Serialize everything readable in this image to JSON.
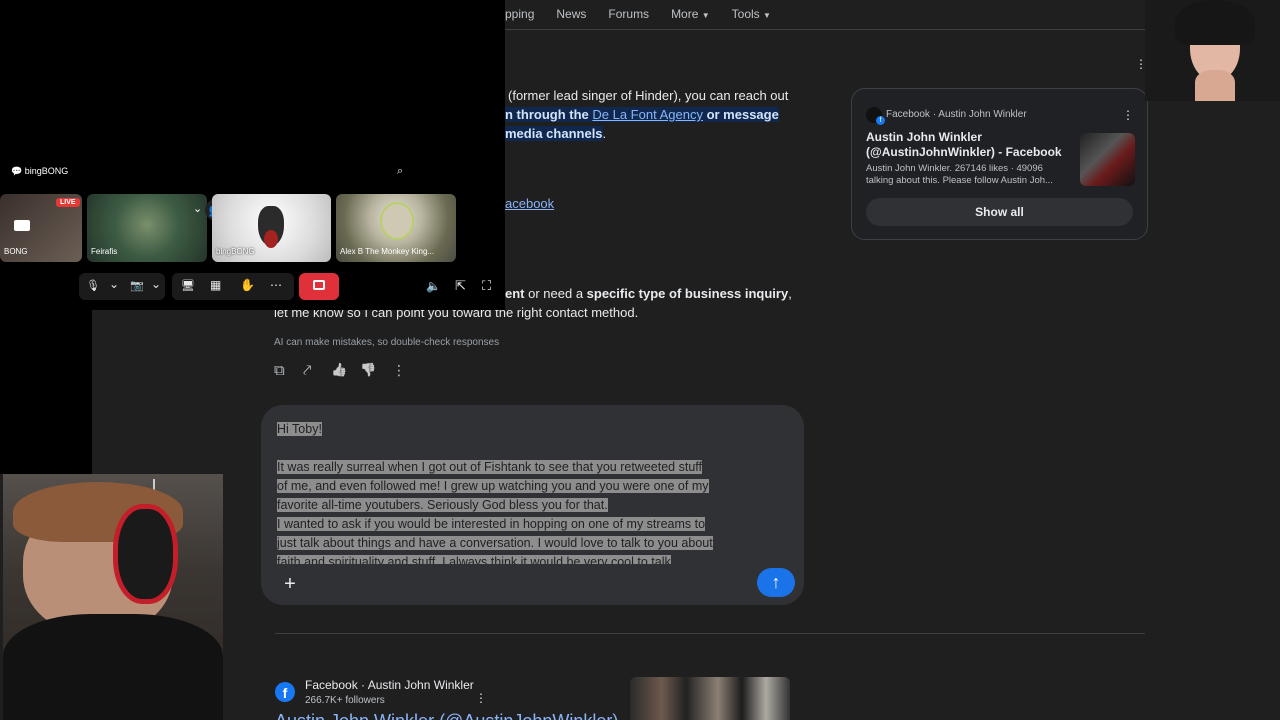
{
  "search_tabs": [
    "pping",
    "News",
    "Forums",
    "More",
    "Tools"
  ],
  "ai_overview": {
    "line1": "(former lead singer of Hinder), you can reach out",
    "line2_pre": "n through the ",
    "line2_link": "De La Font Agency",
    "line2_post": " or message",
    "line3": "media channels",
    "line3_end": ".",
    "facebook_link": "acebook",
    "line4_a": "ent",
    "line4_b": " or need a ",
    "line4_c": "specific type of business inquiry",
    "line4_d": ",",
    "line5": "let me know so I can point you toward the right contact method.",
    "disclaimer": "AI can make mistakes, so double-check responses"
  },
  "knowledge_card": {
    "source": "Facebook",
    "separator": "·",
    "author": "Austin John Winkler",
    "title_line1": "Austin John Winkler",
    "title_line2": "(@AustinJohnWinkler) - Facebook",
    "snippet_line1": "Austin John Winkler. 267146 likes · 49096",
    "snippet_line2": "talking about this. Please follow Austin Joh...",
    "show_all": "Show all"
  },
  "composer": {
    "greeting": "Hi Toby!",
    "lines": [
      "It was really surreal when I got out of Fishtank to see that you retweeted stuff",
      "of me, and even followed me! I grew up watching you and you were one of my",
      "favorite all-time youtubers. Seriously God bless you for that.",
      "I wanted to ask if you would be interested in hopping on one of my streams to",
      "just talk about things and have a conversation. I would love to talk to you about",
      "faith and spirituality and stuff. I always think it would be very cool to talk"
    ]
  },
  "result": {
    "source": "Facebook · Austin John Winkler",
    "followers": "266.7K+ followers",
    "title": "Austin John Winkler (@AustinJohnWinkler)"
  },
  "call": {
    "app_label": "bingBONG",
    "live_badge": "LIVE",
    "participants": [
      "BONG",
      "Feirafis",
      "bingBONG",
      "Alex B The Monkey King..."
    ]
  },
  "icons": {
    "more": "⋮",
    "copy": "⧉",
    "share": "⤤",
    "thumb_up": "👍",
    "thumb_down": "👎",
    "plus": "+",
    "send": "↑",
    "mic": "🎙",
    "chevron": "⌄",
    "zoom": "⌕",
    "volume": "🔈",
    "popout": "⇱",
    "fullscreen": "⛶"
  },
  "colors": {
    "accent_blue": "#8ab4f8",
    "send_button": "#1a73e8",
    "end_call": "#e0303a",
    "highlight": "#10284d"
  }
}
